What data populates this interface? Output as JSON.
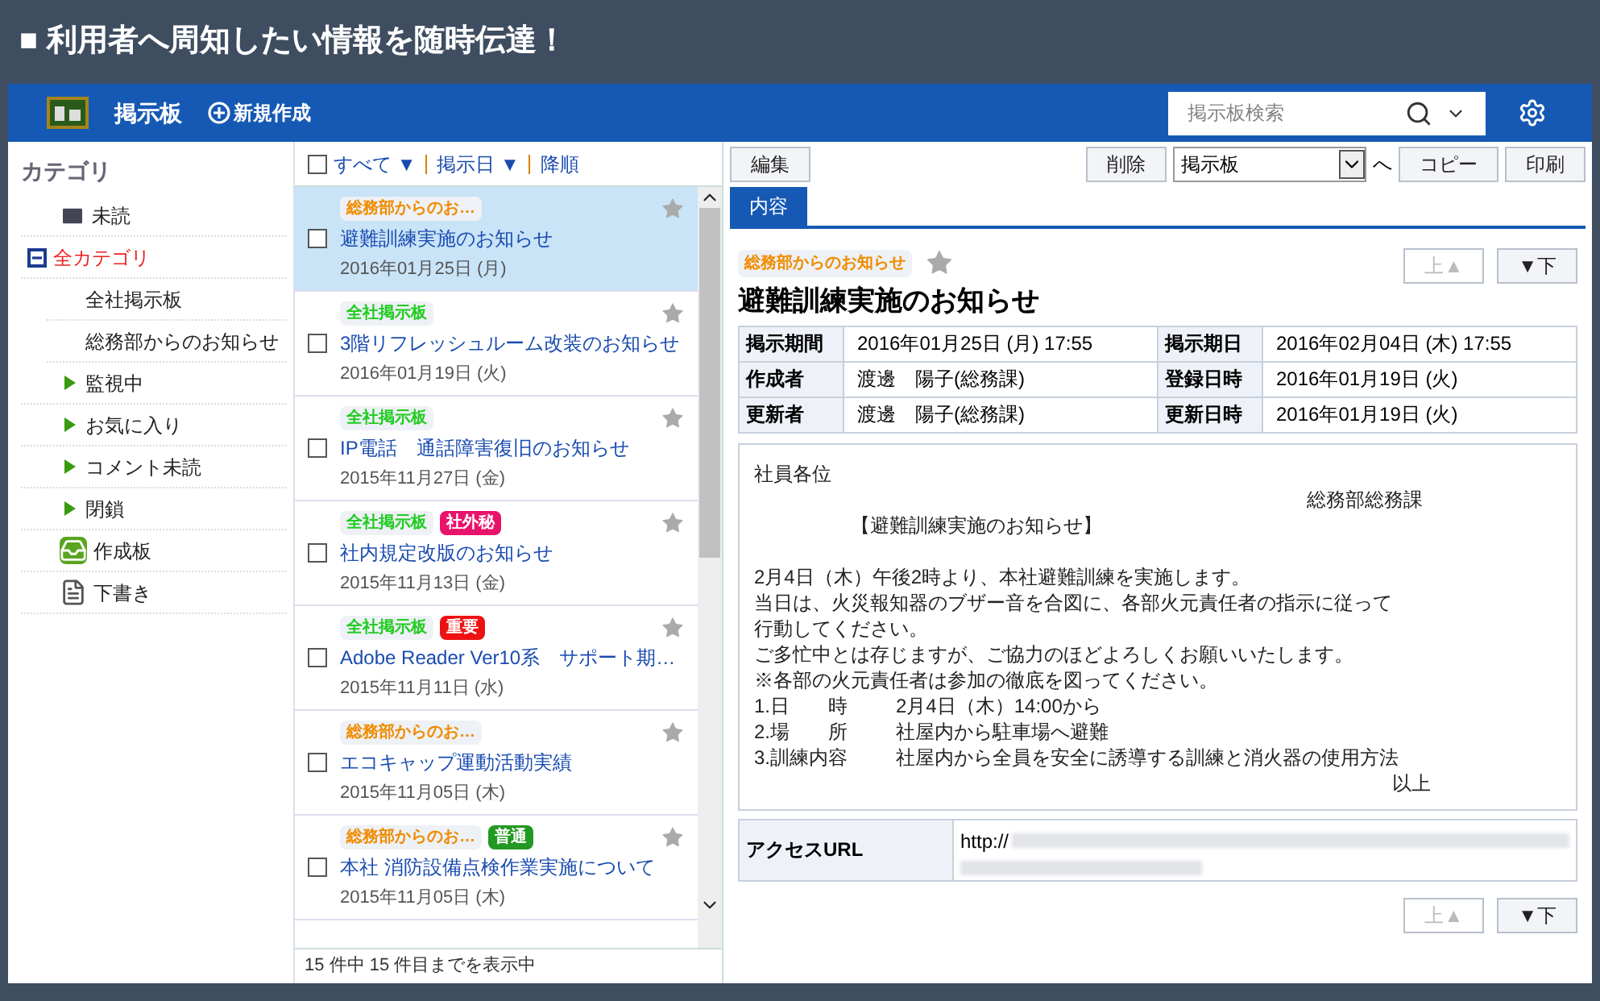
{
  "page_title": "■ 利用者へ周知したい情報を随時伝達！",
  "app": {
    "title": "掲示板",
    "new_button": "新規作成",
    "search": {
      "placeholder": "掲示板検索"
    }
  },
  "sidebar": {
    "heading": "カテゴリ",
    "items": [
      {
        "kind": "mail",
        "label": "未読",
        "selected": false
      },
      {
        "kind": "tree",
        "label": "全カテゴリ",
        "selected": true,
        "expanded": true,
        "children": [
          {
            "label": "全社掲示板",
            "selected": false
          },
          {
            "label": "総務部からのお知らせ",
            "selected": false
          }
        ]
      },
      {
        "kind": "flag",
        "label": "監視中",
        "selected": false
      },
      {
        "kind": "flag",
        "label": "お気に入り",
        "selected": false
      },
      {
        "kind": "flag",
        "label": "コメント未読",
        "selected": false
      },
      {
        "kind": "flag",
        "label": "閉鎖",
        "selected": false
      },
      {
        "kind": "board",
        "label": "作成板",
        "selected": false
      },
      {
        "kind": "draft",
        "label": "下書き",
        "selected": false
      }
    ]
  },
  "list": {
    "select_all": {
      "checked": false
    },
    "toolbar": [
      {
        "label": "すべて ▼"
      },
      {
        "label": "掲示日 ▼"
      },
      {
        "label": "降順"
      }
    ],
    "items": [
      {
        "tags": [
          {
            "text": "総務部からのお…",
            "color": "#f08c00",
            "filled": false
          }
        ],
        "title": "避難訓練実施のお知らせ",
        "date": "2016年01月25日 (月)",
        "selected": true,
        "starred": false,
        "checked": false
      },
      {
        "tags": [
          {
            "text": "全社掲示板",
            "color": "#22cc22",
            "filled": false
          }
        ],
        "title": "3階リフレッシュルーム改装のお知らせ",
        "date": "2016年01月19日 (火)",
        "selected": false,
        "starred": false,
        "checked": false
      },
      {
        "tags": [
          {
            "text": "全社掲示板",
            "color": "#22cc22",
            "filled": false
          }
        ],
        "title": "IP電話　通話障害復旧のお知らせ",
        "date": "2015年11月27日 (金)",
        "selected": false,
        "starred": false,
        "checked": false
      },
      {
        "tags": [
          {
            "text": "全社掲示板",
            "color": "#22cc22",
            "filled": false
          },
          {
            "text": "社外秘",
            "color": "#e8136b",
            "filled": true
          }
        ],
        "title": "社内規定改版のお知らせ",
        "date": "2015年11月13日 (金)",
        "selected": false,
        "starred": false,
        "checked": false
      },
      {
        "tags": [
          {
            "text": "全社掲示板",
            "color": "#22cc22",
            "filled": false
          },
          {
            "text": "重要",
            "color": "#ee1111",
            "filled": true
          }
        ],
        "title": "Adobe Reader Ver10系　サポート期…",
        "date": "2015年11月11日 (水)",
        "selected": false,
        "starred": false,
        "checked": false
      },
      {
        "tags": [
          {
            "text": "総務部からのお…",
            "color": "#f08c00",
            "filled": false
          }
        ],
        "title": "エコキャップ運動活動実績",
        "date": "2015年11月05日 (木)",
        "selected": false,
        "starred": false,
        "checked": false
      },
      {
        "tags": [
          {
            "text": "総務部からのお…",
            "color": "#f08c00",
            "filled": false
          },
          {
            "text": "普通",
            "color": "#229922",
            "filled": true
          }
        ],
        "title": "本社 消防設備点検作業実施について",
        "date": "2015年11月05日 (木)",
        "selected": false,
        "starred": false,
        "checked": false
      }
    ],
    "status": "15 件中 15 件目までを表示中"
  },
  "detail": {
    "toolbar": {
      "edit": "編集",
      "delete": "削除",
      "move_select": "掲示板",
      "move_suffix": "へ",
      "copy": "コピー",
      "print": "印刷"
    },
    "tabs": [
      {
        "label": "内容",
        "selected": true
      }
    ],
    "nav": [
      {
        "label": "上▲",
        "disabled": true
      },
      {
        "label": "▼下",
        "disabled": false
      }
    ],
    "bottom_nav": [
      {
        "label": "上▲",
        "disabled": true
      },
      {
        "label": "▼下",
        "disabled": false
      }
    ],
    "tag": {
      "text": "総務部からのお知らせ",
      "color": "#f08c00"
    },
    "starred": false,
    "title": "避難訓練実施のお知らせ",
    "meta": [
      [
        {
          "label": "掲示期間",
          "value": "2016年01月25日 (月) 17:55"
        },
        {
          "label": "掲示期日",
          "value": "2016年02月04日 (木) 17:55"
        }
      ],
      [
        {
          "label": "作成者",
          "value": "渡邊　陽子(総務課)"
        },
        {
          "label": "登録日時",
          "value": "2016年01月19日 (火)"
        }
      ],
      [
        {
          "label": "更新者",
          "value": "渡邊　陽子(総務課)"
        },
        {
          "label": "更新日時",
          "value": "2016年01月19日 (火)"
        }
      ]
    ],
    "body": [
      {
        "kind": "text",
        "text": "社員各位"
      },
      {
        "kind": "right",
        "text": "総務部総務課"
      },
      {
        "kind": "indent",
        "text": "【避難訓練実施のお知らせ】"
      },
      {
        "kind": "gap"
      },
      {
        "kind": "text",
        "text": "2月4日（木）午後2時より、本社避難訓練を実施します。"
      },
      {
        "kind": "text",
        "text": "当日は、火災報知器のブザー音を合図に、各部火元責任者の指示に従って"
      },
      {
        "kind": "text",
        "text": "行動してください。"
      },
      {
        "kind": "text",
        "text": "ご多忙中とは存じますが、ご協力のほどよろしくお願いいたします。"
      },
      {
        "kind": "text",
        "text": "※各部の火元責任者は参加の徹底を図ってください。"
      },
      {
        "kind": "item",
        "label": "1.日　　時",
        "text": "2月4日（木）14:00から"
      },
      {
        "kind": "item",
        "label": "2.場　　所",
        "text": "社屋内から駐車場へ避難"
      },
      {
        "kind": "item",
        "label": "3.訓練内容",
        "text": "社屋内から全員を安全に誘導する訓練と消火器の使用方法"
      },
      {
        "kind": "end",
        "text": "以上"
      }
    ],
    "url": {
      "label": "アクセスURL",
      "value": "http://"
    }
  }
}
